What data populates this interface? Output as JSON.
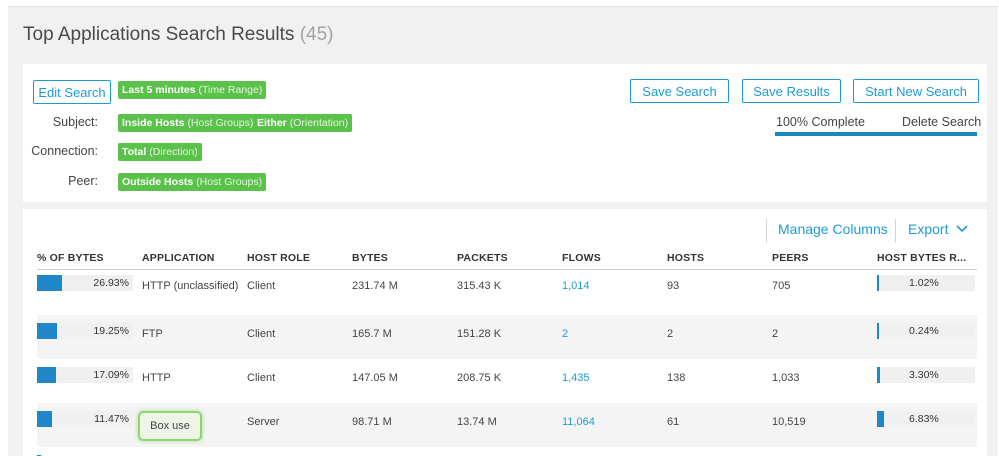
{
  "page": {
    "title": "Top Applications Search Results",
    "count": "(45)"
  },
  "search": {
    "edit_label": "Edit Search",
    "time_tag": {
      "main": "Last 5 minutes",
      "sub": "(Time Range)"
    },
    "subject_label": "Subject:",
    "subject_tags": [
      {
        "main": "Inside Hosts",
        "sub": "(Host Groups)"
      },
      {
        "main": "Either",
        "sub": "(Orientation)"
      }
    ],
    "connection_label": "Connection:",
    "connection_tag": {
      "main": "Total",
      "sub": "(Direction)"
    },
    "peer_label": "Peer:",
    "peer_tag": {
      "main": "Outside Hosts",
      "sub": "(Host Groups)"
    },
    "save_search_label": "Save Search",
    "save_results_label": "Save Results",
    "start_new_label": "Start New Search",
    "progress_text": "100% Complete",
    "progress_value": 1.0,
    "delete_label": "Delete Search"
  },
  "toolbar": {
    "manage_columns": "Manage Columns",
    "export": "Export"
  },
  "table": {
    "headers": [
      "% OF BYTES",
      "APPLICATION",
      "HOST ROLE",
      "BYTES",
      "PACKETS",
      "FLOWS",
      "HOSTS",
      "PEERS",
      "HOST BYTES R..."
    ],
    "rows": [
      {
        "pct": "26.93%",
        "pct_value": 26.93,
        "app": "HTTP (unclassified)",
        "role": "Client",
        "bytes": "231.74 M",
        "packets": "315.43 K",
        "flows": "1,014",
        "hosts": "93",
        "peers": "705",
        "hbr": "1.02%",
        "hbr_value": 1.02
      },
      {
        "pct": "19.25%",
        "pct_value": 19.25,
        "app": "FTP",
        "role": "Client",
        "bytes": "165.7 M",
        "packets": "151.28 K",
        "flows": "2",
        "hosts": "2",
        "peers": "2",
        "hbr": "0.24%",
        "hbr_value": 0.24
      },
      {
        "pct": "17.09%",
        "pct_value": 17.09,
        "app": "HTTP",
        "role": "Client",
        "bytes": "147.05 M",
        "packets": "208.75 K",
        "flows": "1,435",
        "hosts": "138",
        "peers": "1,033",
        "hbr": "3.30%",
        "hbr_value": 3.3
      },
      {
        "pct": "11.47%",
        "pct_value": 11.47,
        "app": "Box use",
        "role": "Server",
        "bytes": "98.71 M",
        "packets": "13.74 M",
        "flows": "11,064",
        "hosts": "61",
        "peers": "10,519",
        "hbr": "6.83%",
        "hbr_value": 6.83
      }
    ]
  },
  "colors": {
    "accent": "#1d9bd7",
    "tag_green": "#5ac24a",
    "bar_blue": "#1f87c8"
  }
}
